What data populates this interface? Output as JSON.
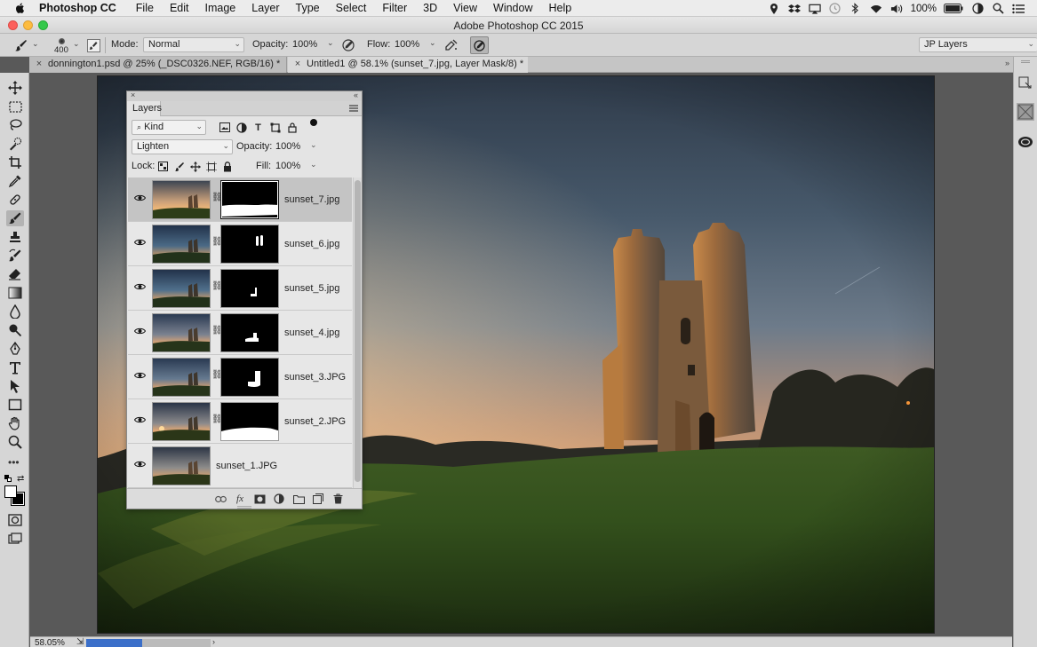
{
  "menubar": {
    "app_name": "Photoshop CC",
    "items": [
      "File",
      "Edit",
      "Image",
      "Layer",
      "Type",
      "Select",
      "Filter",
      "3D",
      "View",
      "Window",
      "Help"
    ],
    "battery": "100%",
    "status_icons": [
      "location-icon",
      "dropbox-icon",
      "airplay-icon",
      "time-machine-icon",
      "bluetooth-icon",
      "wifi-icon",
      "volume-icon",
      "battery-icon",
      "user-icon",
      "spotlight-search-icon",
      "notification-center-icon"
    ]
  },
  "window": {
    "title": "Adobe Photoshop CC 2015"
  },
  "options_bar": {
    "brush_size": "400",
    "mode_label": "Mode:",
    "mode_value": "Normal",
    "opacity_label": "Opacity:",
    "opacity_value": "100%",
    "flow_label": "Flow:",
    "flow_value": "100%",
    "workspace": "JP Layers"
  },
  "tabs": [
    {
      "label": "donnington1.psd @ 25% (_DSC0326.NEF, RGB/16) *",
      "active": false
    },
    {
      "label": "Untitled1 @ 58.1% (sunset_7.jpg, Layer Mask/8) *",
      "active": true
    }
  ],
  "toolbar": {
    "tools": [
      "move-tool-icon",
      "marquee-tool-icon",
      "lasso-tool-icon",
      "quick-selection-tool-icon",
      "crop-tool-icon",
      "eyedropper-tool-icon",
      "spot-healing-tool-icon",
      "brush-tool-icon",
      "clone-stamp-tool-icon",
      "history-brush-tool-icon",
      "eraser-tool-icon",
      "gradient-tool-icon",
      "blur-tool-icon",
      "dodge-tool-icon",
      "pen-tool-icon",
      "type-tool-icon",
      "path-selection-tool-icon",
      "rectangle-tool-icon",
      "hand-tool-icon",
      "zoom-tool-icon"
    ],
    "active_tool": "brush-tool-icon"
  },
  "layers_panel": {
    "tab_label": "Layers",
    "filter_kind": "Kind",
    "blend_mode": "Lighten",
    "opacity_label": "Opacity:",
    "opacity_value": "100%",
    "lock_label": "Lock:",
    "fill_label": "Fill:",
    "fill_value": "100%",
    "layers": [
      {
        "name": "sunset_7.jpg",
        "selected": true,
        "has_mask": true
      },
      {
        "name": "sunset_6.jpg",
        "selected": false,
        "has_mask": true
      },
      {
        "name": "sunset_5.jpg",
        "selected": false,
        "has_mask": true
      },
      {
        "name": "sunset_4.jpg",
        "selected": false,
        "has_mask": true
      },
      {
        "name": "sunset_3.JPG",
        "selected": false,
        "has_mask": true
      },
      {
        "name": "sunset_2.JPG",
        "selected": false,
        "has_mask": true
      },
      {
        "name": "sunset_1.JPG",
        "selected": false,
        "has_mask": false
      }
    ],
    "bottom_icons": [
      "link-layers-icon",
      "fx-icon",
      "add-mask-icon",
      "adjustment-layer-icon",
      "new-group-icon",
      "new-layer-icon",
      "delete-layer-icon"
    ],
    "fx_label": "fx"
  },
  "status_bar": {
    "zoom": "58.05%",
    "progress": 0.45
  }
}
